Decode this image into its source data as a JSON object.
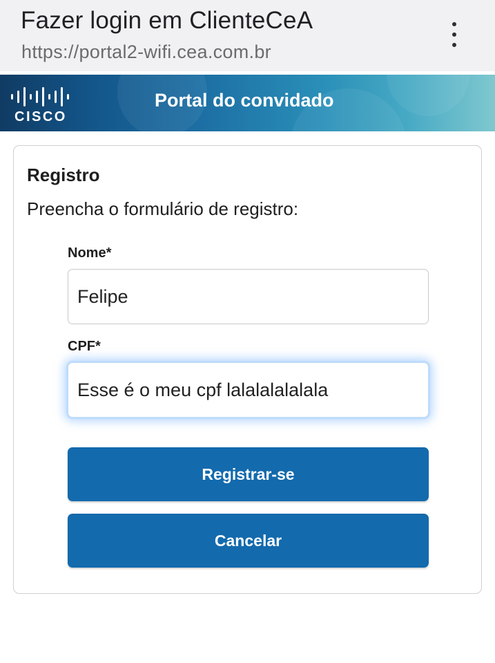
{
  "browser": {
    "title": "Fazer login em ClienteCeA",
    "url": "https://portal2-wifi.cea.com.br",
    "menu_icon": "more-vert-icon"
  },
  "banner": {
    "logo_text": "CISCO",
    "title": "Portal do convidado",
    "gradient_colors": [
      "#103b63",
      "#1c6ea3",
      "#46a9c4",
      "#7fc8cf"
    ]
  },
  "form": {
    "heading": "Registro",
    "subtitle": "Preencha o formulário de registro:",
    "fields": [
      {
        "label": "Nome*",
        "value": "Felipe",
        "focused": false
      },
      {
        "label": "CPF*",
        "value": "Esse é o meu cpf lalalalalalala",
        "focused": true
      }
    ],
    "buttons": {
      "register_label": "Registrar-se",
      "cancel_label": "Cancelar"
    },
    "button_color": "#136aad"
  }
}
